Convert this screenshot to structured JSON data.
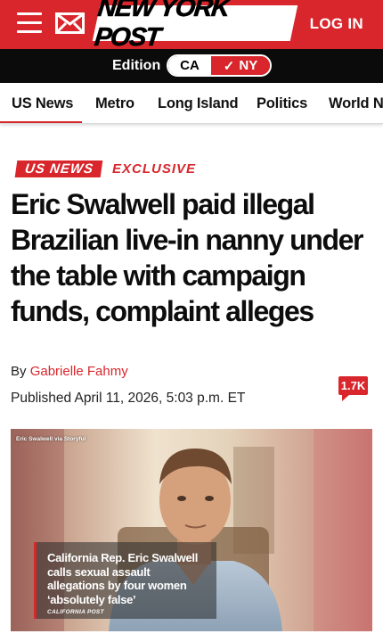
{
  "header": {
    "logo_text": "NEW YORK POST",
    "login_label": "LOG IN",
    "brand_color": "#d8262c"
  },
  "edition": {
    "label": "Edition",
    "options": [
      "CA",
      "NY"
    ],
    "selected": "NY",
    "check_glyph": "✓"
  },
  "nav": {
    "items": [
      {
        "label": "US News",
        "active": true
      },
      {
        "label": "Metro"
      },
      {
        "label": "Long Island"
      },
      {
        "label": "Politics"
      },
      {
        "label": "World News"
      }
    ]
  },
  "article": {
    "section_tag": "US NEWS",
    "exclusive_tag": "EXCLUSIVE",
    "headline": "Eric Swalwell paid illegal Brazilian live-in nanny under the table with campaign funds, complaint alleges",
    "by_prefix": "By",
    "author": "Gabrielle Fahmy",
    "published": "Published April 11, 2026, 5:03 p.m. ET",
    "comment_count": "1.7K"
  },
  "video": {
    "credit": "Eric Swalwell via Storyful",
    "caption": "California Rep. Eric Swalwell calls sexual assault allegations by four women ‘absolutely false’",
    "caption_source": "CALIFORNIA POST"
  }
}
